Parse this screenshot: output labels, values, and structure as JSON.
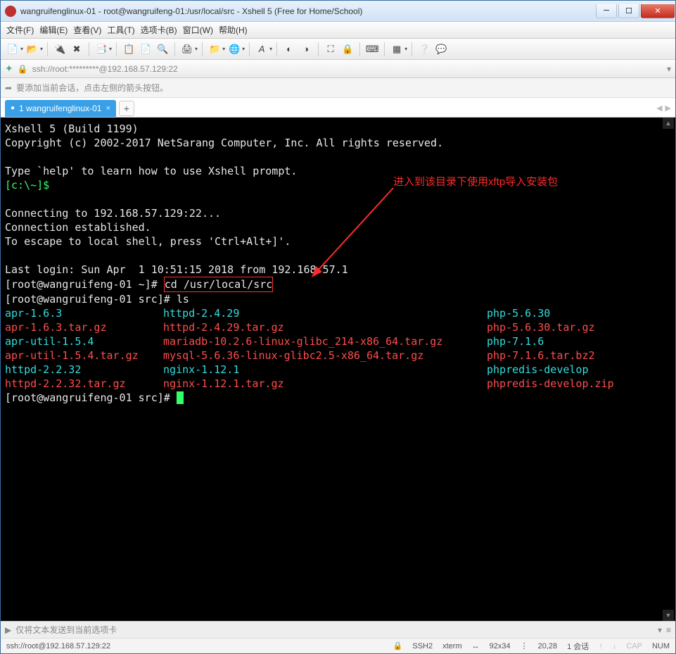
{
  "window": {
    "title": "wangruifenglinux-01 - root@wangruifeng-01:/usr/local/src - Xshell 5 (Free for Home/School)"
  },
  "menu": [
    "文件(F)",
    "编辑(E)",
    "查看(V)",
    "工具(T)",
    "选项卡(B)",
    "窗口(W)",
    "帮助(H)"
  ],
  "address": "ssh://root:*********@192.168.57.129:22",
  "hint": "要添加当前会话，点击左侧的箭头按钮。",
  "tab": {
    "label": "1 wangruifenglinux-01"
  },
  "annotation": "进入到该目录下使用xftp导入安装包",
  "term": {
    "l1": "Xshell 5 (Build 1199)",
    "l2": "Copyright (c) 2002-2017 NetSarang Computer, Inc. All rights reserved.",
    "l3": "Type `help' to learn how to use Xshell prompt.",
    "prompt_local": "[c:\\~]$",
    "l4": "Connecting to 192.168.57.129:22...",
    "l5": "Connection established.",
    "l6": "To escape to local shell, press 'Ctrl+Alt+]'.",
    "l7": "Last login: Sun Apr  1 10:51:15 2018 from 192.168.57.1",
    "p1": "[root@wangruifeng-01 ~]# ",
    "cmd1": "cd /usr/local/src",
    "p2": "[root@wangruifeng-01 src]# ",
    "cmd2": "ls",
    "p3": "[root@wangruifeng-01 src]# ",
    "ls": {
      "c1": [
        "apr-1.6.3",
        "apr-1.6.3.tar.gz",
        "apr-util-1.5.4",
        "apr-util-1.5.4.tar.gz",
        "httpd-2.2.32",
        "httpd-2.2.32.tar.gz"
      ],
      "c1_t": [
        "c",
        "r",
        "c",
        "r",
        "c",
        "r"
      ],
      "c2": [
        "httpd-2.4.29",
        "httpd-2.4.29.tar.gz",
        "mariadb-10.2.6-linux-glibc_214-x86_64.tar.gz",
        "mysql-5.6.36-linux-glibc2.5-x86_64.tar.gz",
        "nginx-1.12.1",
        "nginx-1.12.1.tar.gz"
      ],
      "c2_t": [
        "c",
        "r",
        "r",
        "r",
        "c",
        "r"
      ],
      "c3": [
        "php-5.6.30",
        "php-5.6.30.tar.gz",
        "php-7.1.6",
        "php-7.1.6.tar.bz2",
        "phpredis-develop",
        "phpredis-develop.zip"
      ],
      "c3_t": [
        "c",
        "r",
        "c",
        "r",
        "c",
        "r"
      ]
    }
  },
  "bottombar": "仅将文本发送到当前选项卡",
  "status": {
    "conn": "ssh://root@192.168.57.129:22",
    "proto": "SSH2",
    "term": "xterm",
    "size": "92x34",
    "pos": "20,28",
    "sess": "1 会话",
    "cap": "CAP",
    "num": "NUM"
  }
}
